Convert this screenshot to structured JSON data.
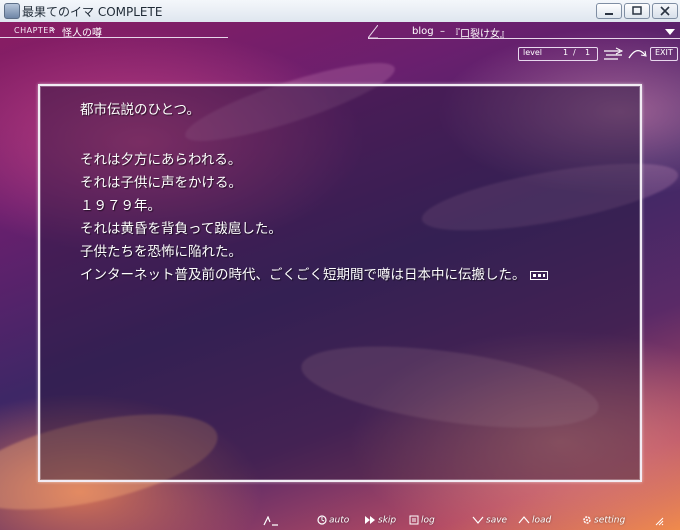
{
  "window": {
    "title": "最果てのイマ COMPLETE"
  },
  "chapter": {
    "tag": "CHAPTER",
    "separator": "»",
    "title": "怪人の噂"
  },
  "blog": {
    "label": "blog",
    "dash": "–",
    "title": "『口裂け女』"
  },
  "level": {
    "label": "level",
    "current": "1",
    "slash": "/",
    "max": "1"
  },
  "exit_label": "EXIT",
  "message": {
    "lines": [
      "都市伝説のひとつ。",
      "",
      "それは夕方にあらわれる。",
      "それは子供に声をかける。",
      "１９７９年。",
      "それは黄昏を背負って跋扈した。",
      "子供たちを恐怖に陥れた。",
      "インターネット普及前の時代、ごくごく短期間で噂は日本中に伝搬した。"
    ]
  },
  "menu": {
    "auto": "auto",
    "skip": "skip",
    "log": "log",
    "save": "save",
    "load": "load",
    "setting": "setting"
  },
  "colors": {
    "text": "#ffffff",
    "frame": "#f2ecf4"
  }
}
